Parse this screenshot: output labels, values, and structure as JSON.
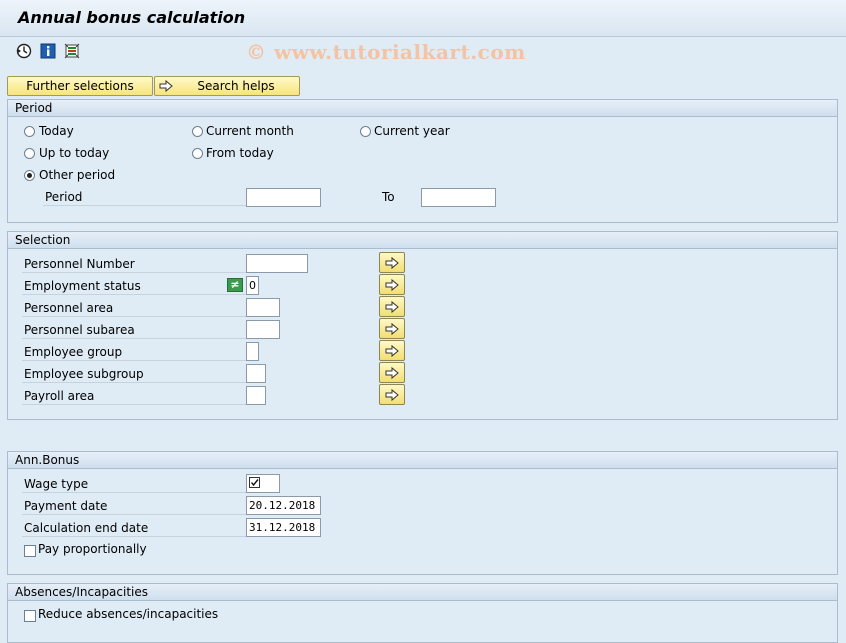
{
  "window": {
    "title": "Annual bonus calculation"
  },
  "toolbar": {
    "icons": [
      "execute-icon",
      "info-icon",
      "selection-options-icon"
    ],
    "watermark": "© www.tutorialkart.com"
  },
  "buttons": {
    "further_selections": "Further selections",
    "search_helps": "Search helps"
  },
  "period": {
    "title": "Period",
    "options": {
      "today": "Today",
      "current_month": "Current month",
      "current_year": "Current year",
      "up_to_today": "Up to today",
      "from_today": "From today",
      "other_period": "Other period"
    },
    "selected": "other_period",
    "period_label": "Period",
    "period_from": "",
    "to_label": "To",
    "period_to": ""
  },
  "selection": {
    "title": "Selection",
    "fields": [
      {
        "label": "Personnel Number",
        "value": ""
      },
      {
        "label": "Employment status",
        "value": "0",
        "operator": "≠"
      },
      {
        "label": "Personnel area",
        "value": ""
      },
      {
        "label": "Personnel subarea",
        "value": ""
      },
      {
        "label": "Employee group",
        "value": ""
      },
      {
        "label": "Employee subgroup",
        "value": ""
      },
      {
        "label": "Payroll area",
        "value": ""
      }
    ]
  },
  "ann_bonus": {
    "title": "Ann.Bonus",
    "wage_type_label": "Wage type",
    "wage_type_value": "",
    "payment_date_label": "Payment date",
    "payment_date": "20.12.2018",
    "calc_end_label": "Calculation end date",
    "calc_end_date": "31.12.2018",
    "pay_proportionally_label": "Pay proportionally",
    "pay_proportionally": false
  },
  "absences": {
    "title": "Absences/Incapacities",
    "reduce_label": "Reduce absences/incapacities",
    "reduce": false
  },
  "colors": {
    "background": "#dfebf5",
    "button_yellow": "#f7e47c",
    "group_border": "#a9bcd0"
  }
}
